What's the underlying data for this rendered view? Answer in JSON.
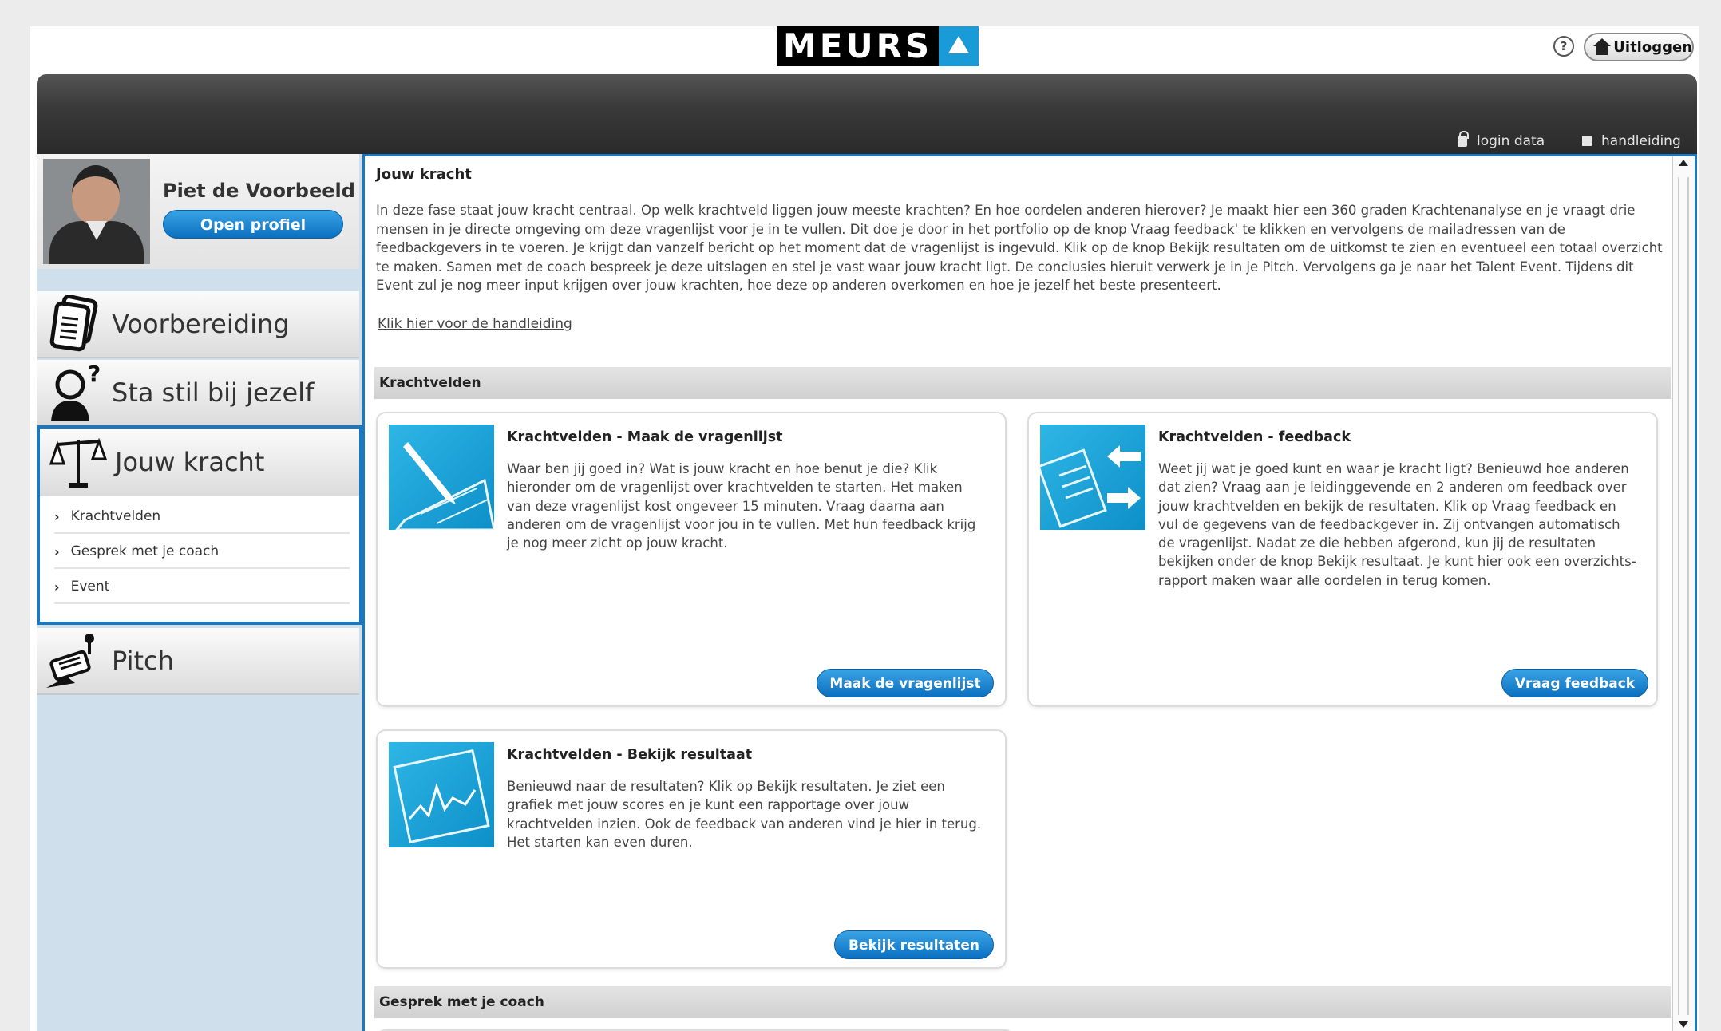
{
  "brand": {
    "logo_text": "MEURS",
    "accent": "#1a9ad6"
  },
  "header": {
    "help_icon": "question-icon",
    "logout_label": "Uitloggen",
    "links": {
      "login": "login data",
      "manual": "handleiding"
    }
  },
  "profile": {
    "name": "Piet de  Voorbeeld",
    "open_profile_label": "Open profiel"
  },
  "sidebar": {
    "items": [
      {
        "label": "Voorbereiding",
        "icon": "documents-icon"
      },
      {
        "label": "Sta stil bij jezelf",
        "icon": "person-question-icon"
      },
      {
        "label": "Jouw kracht",
        "icon": "scales-icon",
        "active": true,
        "subitems": [
          "Krachtvelden",
          "Gesprek met je coach",
          "Event"
        ]
      },
      {
        "label": "Pitch",
        "icon": "microphone-icon"
      }
    ]
  },
  "main": {
    "title": "Jouw kracht",
    "intro": "In deze fase staat jouw kracht centraal. Op welk krachtveld liggen jouw meeste krachten? En hoe oordelen anderen hierover? Je maakt hier een 360 graden Krachtenanalyse en je vraagt drie mensen in je directe omgeving om deze vragenlijst voor je in te vullen. Dit doe je door in het portfolio op de knop Vraag feedback' te klikken en vervolgens de mailadressen van de feedbackgevers in te voeren. Je krijgt dan vanzelf bericht op het moment dat de vragenlijst is ingevuld. Klik op de knop Bekijk resultaten om de uitkomst te zien en eventueel een totaal overzicht te maken. Samen met de coach bespreek je deze uitslagen en stel je vast waar jouw kracht ligt. De conclusies hieruit verwerk je in je Pitch. Vervolgens ga je naar het Talent Event. Tijdens dit Event zul je nog meer input krijgen over jouw krachten, hoe deze op anderen overkomen en hoe je jezelf het beste presenteert.",
    "manual_link": " Klik hier voor de handleiding",
    "sections": {
      "krachtvelden": "Krachtvelden",
      "gesprek": "Gesprek met je coach"
    },
    "cards": [
      {
        "title": "Krachtvelden - Maak de vragenlijst",
        "text": "Waar ben jij goed in? Wat is jouw kracht en hoe benut je die? Klik hieronder om de vragenlijst over krachtvelden te starten. Het maken van deze vragenlijst kost ongeveer 15 minuten. Vraag daarna aan anderen om de vragenlijst voor jou in te vullen. Met hun feedback krijg je nog meer zicht op jouw kracht.",
        "button": "Maak de vragenlijst"
      },
      {
        "title": "Krachtvelden -  feedback",
        "text": "Weet jij wat je goed kunt en waar je kracht ligt? Benieuwd hoe anderen dat zien? Vraag aan je leidinggevende en 2 anderen om feedback over jouw krachtvelden en bekijk de resultaten. Klik op Vraag feedback en vul de gegevens van de feedbackgever in. Zij ontvangen automatisch de vragenlijst. Nadat ze die hebben afgerond, kun jij de resultaten bekijken onder de knop Bekijk resultaat. Je kunt hier ook een overzichts-rapport maken waar alle oordelen in terug komen.",
        "button": "Vraag feedback"
      },
      {
        "title": "Krachtvelden - Bekijk resultaat",
        "text": "Benieuwd naar de resultaten? Klik op Bekijk resultaten. Je ziet een grafiek met jouw scores en je kunt een rapportage over jouw krachtvelden inzien. Ook de feedback van anderen vind je hier in terug. Het starten kan even duren.",
        "button": "Bekijk resultaten"
      }
    ]
  }
}
